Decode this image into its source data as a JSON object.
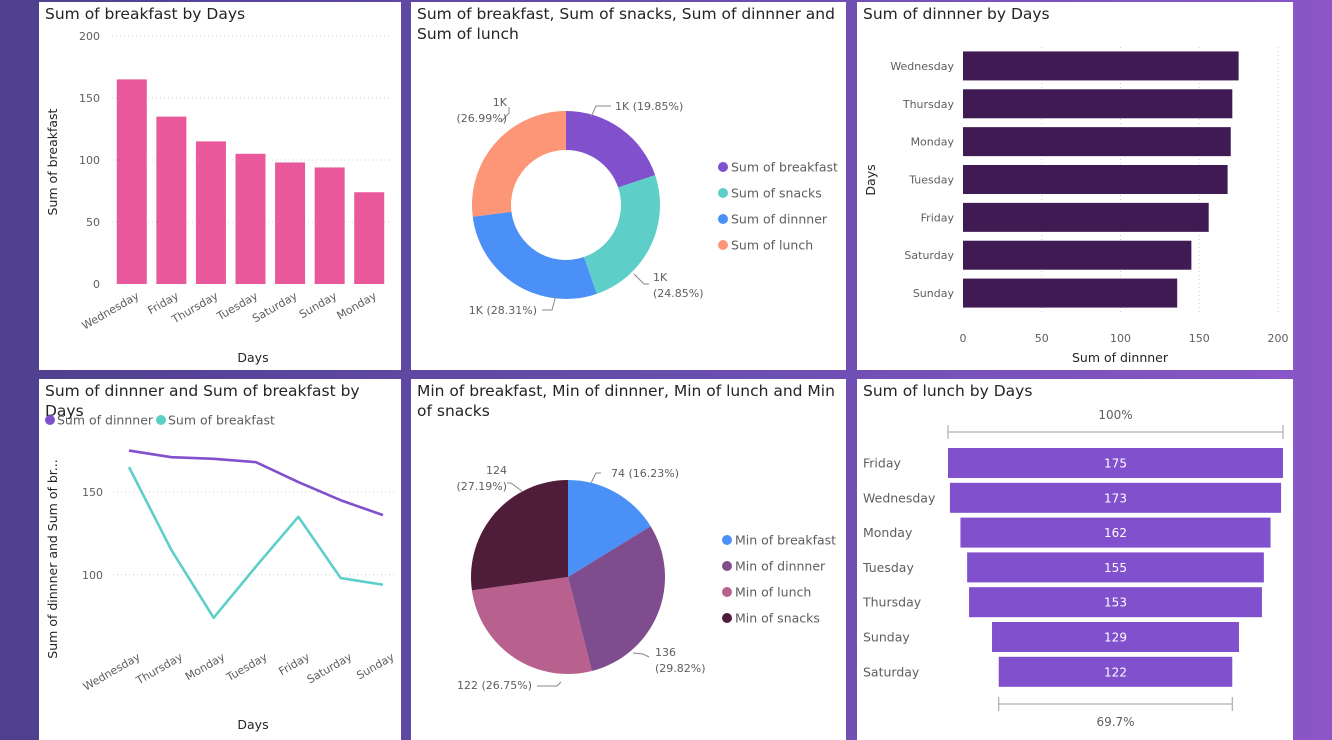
{
  "colors": {
    "breakfast_bar": "#e8589a",
    "dinner_bar": "#401a52",
    "lunch_funnel": "#8150cc",
    "donut": [
      "#8150cc",
      "#5ecfc8",
      "#4a90f7",
      "#fd9577"
    ],
    "pie": [
      "#4a90f7",
      "#7f4d8e",
      "#b8608e",
      "#4f1d3a"
    ],
    "line_dinner": "#8150cc",
    "line_breakfast": "#5ecfc8"
  },
  "chart_data": [
    {
      "id": "breakfast",
      "type": "bar",
      "title": "Sum of breakfast by Days",
      "xlabel": "Days",
      "ylabel": "Sum of breakfast",
      "categories": [
        "Wednesday",
        "Friday",
        "Thursday",
        "Tuesday",
        "Saturday",
        "Sunday",
        "Monday"
      ],
      "values": [
        165,
        135,
        115,
        105,
        98,
        94,
        74
      ],
      "ylim": [
        0,
        200
      ],
      "yticks": [
        "0",
        "50",
        "100",
        "150",
        "200"
      ],
      "grid": true
    },
    {
      "id": "donut",
      "type": "pie",
      "title": "Sum of breakfast, Sum of snacks, Sum of dinnner and Sum of lunch",
      "values": [
        19.85,
        24.85,
        28.31,
        26.99
      ],
      "labels": [
        [
          "1K (19.85%)"
        ],
        [
          "1K",
          "(24.85%)"
        ],
        [
          "1K (28.31%)"
        ],
        [
          "1K",
          "(26.99%)"
        ]
      ],
      "legend": [
        "Sum of breakfast",
        "Sum of snacks",
        "Sum of dinnner",
        "Sum of lunch"
      ],
      "legend_position": "right"
    },
    {
      "id": "dinner",
      "type": "bar",
      "orientation": "horizontal",
      "title": "Sum of dinnner by Days",
      "xlabel": "Sum of dinnner",
      "ylabel": "Days",
      "categories": [
        "Wednesday",
        "Thursday",
        "Monday",
        "Tuesday",
        "Friday",
        "Saturday",
        "Sunday"
      ],
      "values": [
        175,
        171,
        170,
        168,
        156,
        145,
        136
      ],
      "xlim": [
        0,
        200
      ],
      "xticks": [
        "0",
        "50",
        "100",
        "150",
        "200"
      ],
      "grid": true
    },
    {
      "id": "line",
      "type": "line",
      "title": "Sum of dinnner and Sum of breakfast by Days",
      "xlabel": "Days",
      "ylabel": "Sum of dinnner and Sum of br...",
      "categories": [
        "Wednesday",
        "Thursday",
        "Monday",
        "Tuesday",
        "Friday",
        "Saturday",
        "Sunday"
      ],
      "series": [
        {
          "name": "Sum of dinnner",
          "values": [
            175,
            171,
            170,
            168,
            156,
            145,
            136
          ]
        },
        {
          "name": "Sum of breakfast",
          "values": [
            165,
            115,
            74,
            105,
            135,
            98,
            94
          ]
        }
      ],
      "ylim": [
        60,
        185
      ],
      "yticks": [
        {
          "label": "100",
          "value": 100
        },
        {
          "label": "150",
          "value": 150
        }
      ],
      "grid": true,
      "legend_position": "top-left"
    },
    {
      "id": "pie",
      "type": "pie",
      "title": "Min of breakfast, Min of dinnner, Min of lunch and Min of snacks",
      "values": [
        74,
        136,
        122,
        124
      ],
      "labels": [
        [
          "74 (16.23%)"
        ],
        [
          "136",
          "(29.82%)"
        ],
        [
          "122 (26.75%)"
        ],
        [
          "124",
          "(27.19%)"
        ]
      ],
      "legend": [
        "Min of breakfast",
        "Min of dinnner",
        "Min of lunch",
        "Min of snacks"
      ],
      "legend_position": "right"
    },
    {
      "id": "funnel",
      "type": "bar",
      "orientation": "funnel",
      "title": "Sum of lunch by Days",
      "categories": [
        "Friday",
        "Wednesday",
        "Monday",
        "Tuesday",
        "Thursday",
        "Sunday",
        "Saturday"
      ],
      "values": [
        175,
        173,
        162,
        155,
        153,
        129,
        122
      ],
      "top_label": "100%",
      "bottom_label": "69.7%"
    }
  ]
}
